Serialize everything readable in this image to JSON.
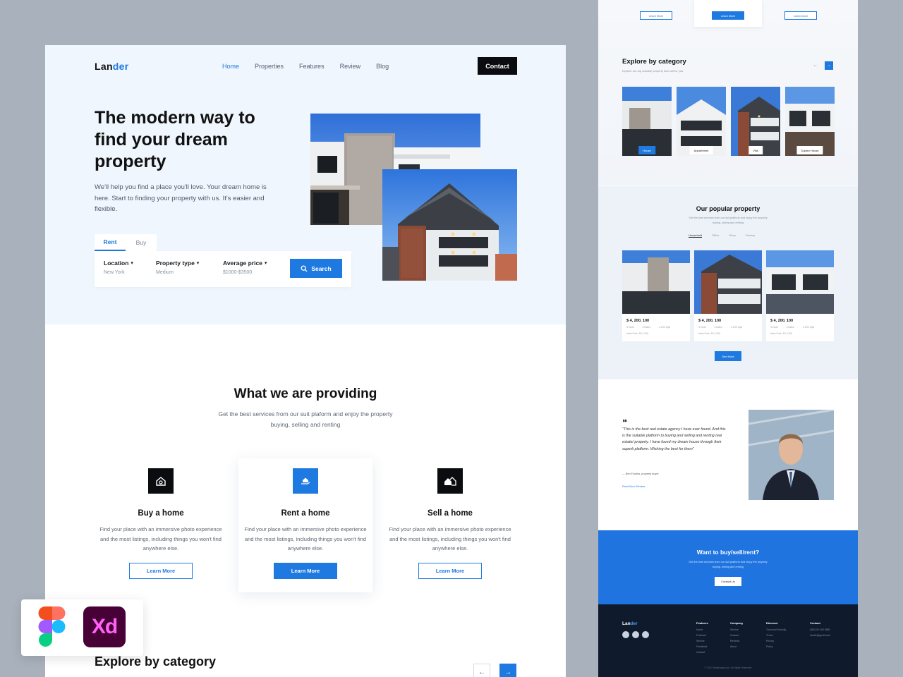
{
  "nav": {
    "logo_a": "Lan",
    "logo_b": "der",
    "links": [
      "Home",
      "Properties",
      "Features",
      "Review",
      "Blog"
    ],
    "contact": "Contact"
  },
  "hero": {
    "title": "The modern way to find your dream property",
    "description": "We'll help you find a place you'll love. Your dream home is here. Start to finding your property with us. It's easier and flexible.",
    "tabs": [
      "Rent",
      "Buy"
    ],
    "fields": [
      {
        "label": "Location",
        "value": "New York"
      },
      {
        "label": "Property type",
        "value": "Medium"
      },
      {
        "label": "Average price",
        "value": "$1000-$3500"
      }
    ],
    "search_label": "Search"
  },
  "providing": {
    "title": "What we are providing",
    "subtitle": "Get the best services from our suit plaform and enjoy the property buying, selling and renting",
    "cards": [
      {
        "title": "Buy a home",
        "desc": "Find your place with an immersive photo experience and the most listings, including things you won't find anywhere else.",
        "button": "Learn More",
        "icon": "home-search-icon"
      },
      {
        "title": "Rent a home",
        "desc": "Find your place with an immersive photo experience and the most listings, including things you won't find anywhere else.",
        "button": "Learn More",
        "icon": "hand-home-icon"
      },
      {
        "title": "Sell a home",
        "desc": "Find your place with an immersive photo experience and the most listings, including things you won't find anywhere else.",
        "button": "Learn More",
        "icon": "houses-icon"
      }
    ]
  },
  "explore": {
    "title": "Explore by category",
    "prev": "←",
    "next": "→"
  },
  "side": {
    "top_buttons": [
      "Learn More",
      "Learn More",
      "Learn More"
    ],
    "explore_title": "Explore by category",
    "explore_sub": "Explore our top suitable property that suit for you.",
    "categories": [
      "House",
      "Appartment",
      "Villa",
      "Duplex House"
    ],
    "popular_title": "Our popular property",
    "popular_sub": "Get the best services from our suit platform and enjoy the property buying, selling and renting",
    "popular_tabs": [
      "Household",
      "Office",
      "Shop",
      "Factory"
    ],
    "properties": [
      {
        "price": "$ 4, 200, 100",
        "beds": "4 beds",
        "baths": "3 baths",
        "area": "4,200 Sqft",
        "addr": "Main Park, NY, USA"
      },
      {
        "price": "$ 4, 200, 100",
        "beds": "4 beds",
        "baths": "3 baths",
        "area": "4,200 Sqft",
        "addr": "Main Park, NY, USA"
      },
      {
        "price": "$ 4, 200, 100",
        "beds": "4 beds",
        "baths": "3 baths",
        "area": "4,200 Sqft",
        "addr": "Main Park, NY, USA"
      }
    ],
    "see_more": "See More",
    "quote_mark": "❝",
    "review_text": "\"This is the best real estate agency I have ever found. And this is the suitable platform to buying and selling and renting real estate/ property. I have found my dream house through their superb platform. Wishing the best for them\"",
    "reviewer": "— Ben Fookes, property buyer",
    "review_link": "Read More Review",
    "cta_title": "Want to buy/sell/rent?",
    "cta_sub": "Get the best services from our suit platform and enjoy the property buying, selling and renting",
    "cta_button": "Contact Us",
    "footer_logo_a": "Lan",
    "footer_logo_b": "der",
    "footer_cols": [
      {
        "heading": "Features",
        "items": [
          "Home",
          "Featured",
          "Service",
          "Feedback",
          "Contact"
        ]
      },
      {
        "heading": "Company",
        "items": [
          "Service",
          "Contact",
          "Reviews",
          "About"
        ]
      },
      {
        "heading": "Discover",
        "items": [
          "Trust and Security",
          "Terms",
          "Pricing",
          "Policy"
        ]
      },
      {
        "heading": "Contact",
        "items": [
          "(082) 00 400 3580",
          "lander@gmail.com"
        ]
      }
    ],
    "copyright": "© 2022 landerapp.com. All rights Reserved"
  },
  "apps": {
    "xd": "Xd"
  },
  "colors": {
    "accent": "#1e7ae0",
    "dark": "#0a0c10",
    "footer": "#0f1b2c"
  }
}
